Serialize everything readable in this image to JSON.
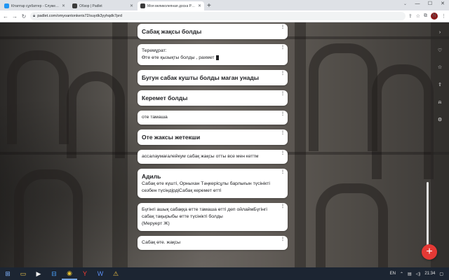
{
  "browser": {
    "tabs": [
      {
        "title": "Кітаптар сұхбатгер - Служебное",
        "favicon_color": "#2196f3",
        "active": false
      },
      {
        "title": "Обзор | Padlet",
        "favicon_color": "#3a3a3a",
        "active": false
      },
      {
        "title": "Моя великолепная доска Padlet",
        "favicon_color": "#3a3a3a",
        "active": true
      }
    ],
    "url": "padlet.com/omyoantonkeris72/suydk3yyhqdk7prd",
    "profile_initial": "N"
  },
  "cards": [
    {
      "title": "Сабақ жақсы болды",
      "body": []
    },
    {
      "title": "",
      "body": [
        "Теремұрат:",
        "Өте өте қызықты болды , рахмет"
      ],
      "has_glyph": true
    },
    {
      "title": "Бугун сабак кушты болды маган унады",
      "body": []
    },
    {
      "title": "Керемет болды",
      "body": []
    },
    {
      "title": "",
      "body": [
        "оте тамаша"
      ]
    },
    {
      "title": "Оте жаксы жетекши",
      "body": []
    },
    {
      "title": "",
      "body": [
        "ассалаумағалейкум сабақ жақсы отты все мен кеттм"
      ]
    },
    {
      "title": "Адиль",
      "body": [
        "Сабақ өте күшті, Орныхан Тәңкерісұлы барлығын түсінікті",
        "сезбен түсіндірдіСабақ керемет өтті"
      ]
    },
    {
      "title": "",
      "body": [
        "Бүгінгі ашық сабаққа өтте тамаша өтті деп ойлаймБүгінгі",
        "сабақ тақырыбы өтте түсінікті болды",
        "(Меруерт Ж)"
      ]
    },
    {
      "title": "",
      "body": [
        "Сабақ өте. жақсы"
      ]
    }
  ],
  "taskbar": {
    "language": "EN",
    "time": "21:34"
  }
}
